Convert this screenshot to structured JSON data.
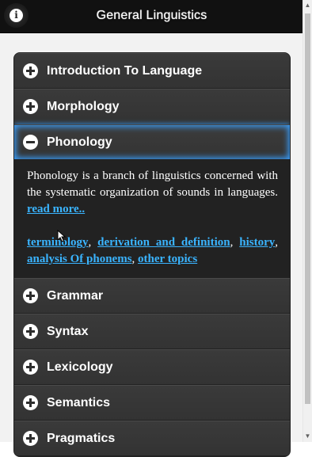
{
  "header": {
    "title": "General Linguistics",
    "info_icon": "info-icon"
  },
  "accordion": {
    "items": [
      {
        "label": "Introduction To Language",
        "expanded": false
      },
      {
        "label": "Morphology",
        "expanded": false
      },
      {
        "label": "Phonology",
        "expanded": true
      },
      {
        "label": "Grammar",
        "expanded": false
      },
      {
        "label": "Syntax",
        "expanded": false
      },
      {
        "label": "Lexicology",
        "expanded": false
      },
      {
        "label": "Semantics",
        "expanded": false
      },
      {
        "label": "Pragmatics",
        "expanded": false
      }
    ],
    "phonology_body": {
      "text": "Phonology is a branch of linguistics concerned with the systematic organization of sounds in languages.",
      "read_more": "read more..",
      "links": [
        "terminology",
        "derivation and definition",
        "history",
        "analysis Of phonems",
        "other topics"
      ]
    }
  },
  "colors": {
    "header_bg": "#111111",
    "panel_bg": "#2e2e2e",
    "link": "#3ab4ff",
    "focus_glow": "#3aa0ff"
  }
}
